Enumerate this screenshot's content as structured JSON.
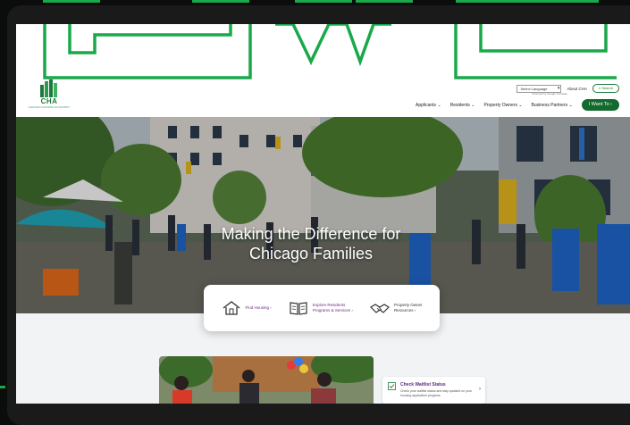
{
  "logo": {
    "abbr": "CHA",
    "name": "CHICAGO HOUSING AUTHORITY"
  },
  "utility": {
    "language_select": "Select Language",
    "powered_by": "Powered by Google Translate",
    "about_link": "About CHA",
    "search_label": "Search"
  },
  "nav": {
    "items": [
      "Applicants ⌄",
      "Residents ⌄",
      "Property Owners ⌄",
      "Business Partners ⌄"
    ],
    "cta": "I Want To  ›"
  },
  "hero": {
    "title_line1": "Making the Difference for",
    "title_line2": "Chicago Families"
  },
  "quick_links": [
    {
      "label": "Find Housing ›",
      "icon": "house-icon"
    },
    {
      "label_line1": "Explore Residents",
      "label_line2": "Programs & Services ›",
      "icon": "book-icon"
    },
    {
      "label_line1": "Property Owner",
      "label_line2": "Resources ›",
      "icon": "handshake-icon"
    }
  ],
  "waitlist": {
    "title": "Check Waitlist Status",
    "text": "Check your waitlist status and stay updated on your housing application progress."
  },
  "colors": {
    "brand_green": "#14692f",
    "accent_purple": "#6a2a80",
    "outline_green": "#19a84a"
  }
}
